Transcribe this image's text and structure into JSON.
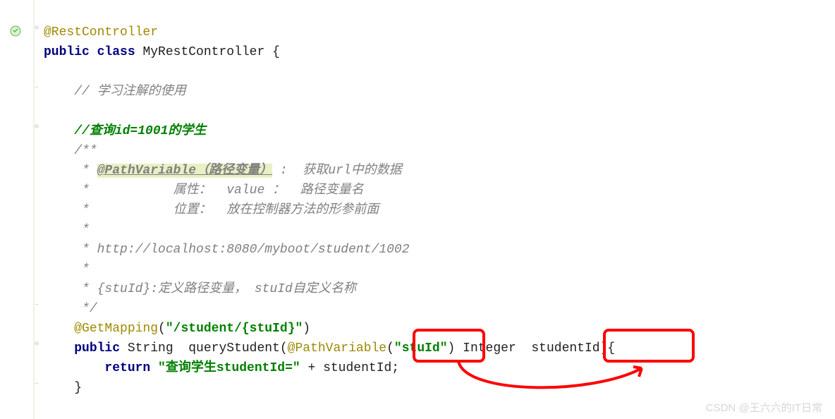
{
  "lines": {
    "l1_anno": "@RestController",
    "l2_kw1": "public",
    "l2_kw2": "class",
    "l2_rest": " MyRestController {",
    "l4": "// 学习注解的使用",
    "l6": "//查询id=1001的学生",
    "l7": "/**",
    "l8_p": " * ",
    "l8_hl": "@PathVariable（路径变量）",
    "l8_rest": " :  获取url中的数据",
    "l9": " *           属性：  value ：  路径变量名",
    "l10": " *           位置：  放在控制器方法的形参前面",
    "l11": " *",
    "l12": " * http://localhost:8080/myboot/student/1002",
    "l13": " *",
    "l14": " * {stuId}:定义路径变量， stuId自定义名称",
    "l15": " */",
    "l16_anno": "@GetMapping",
    "l16_p1": "(",
    "l16_str": "\"/student/{stuId}\"",
    "l16_p2": ")",
    "l17_kw": "public",
    "l17_t1": " String  queryStudent(",
    "l17_anno": "@PathVariable",
    "l17_p1": "(",
    "l17_str": "\"stuId\"",
    "l17_t2": ") Integer  studentId){",
    "l18_kw": "return",
    "l18_sp": " ",
    "l18_str": "\"查询学生studentId=\"",
    "l18_t": " + studentId;",
    "l19": "}"
  },
  "watermark": "CSDN @王六六的IT日常"
}
